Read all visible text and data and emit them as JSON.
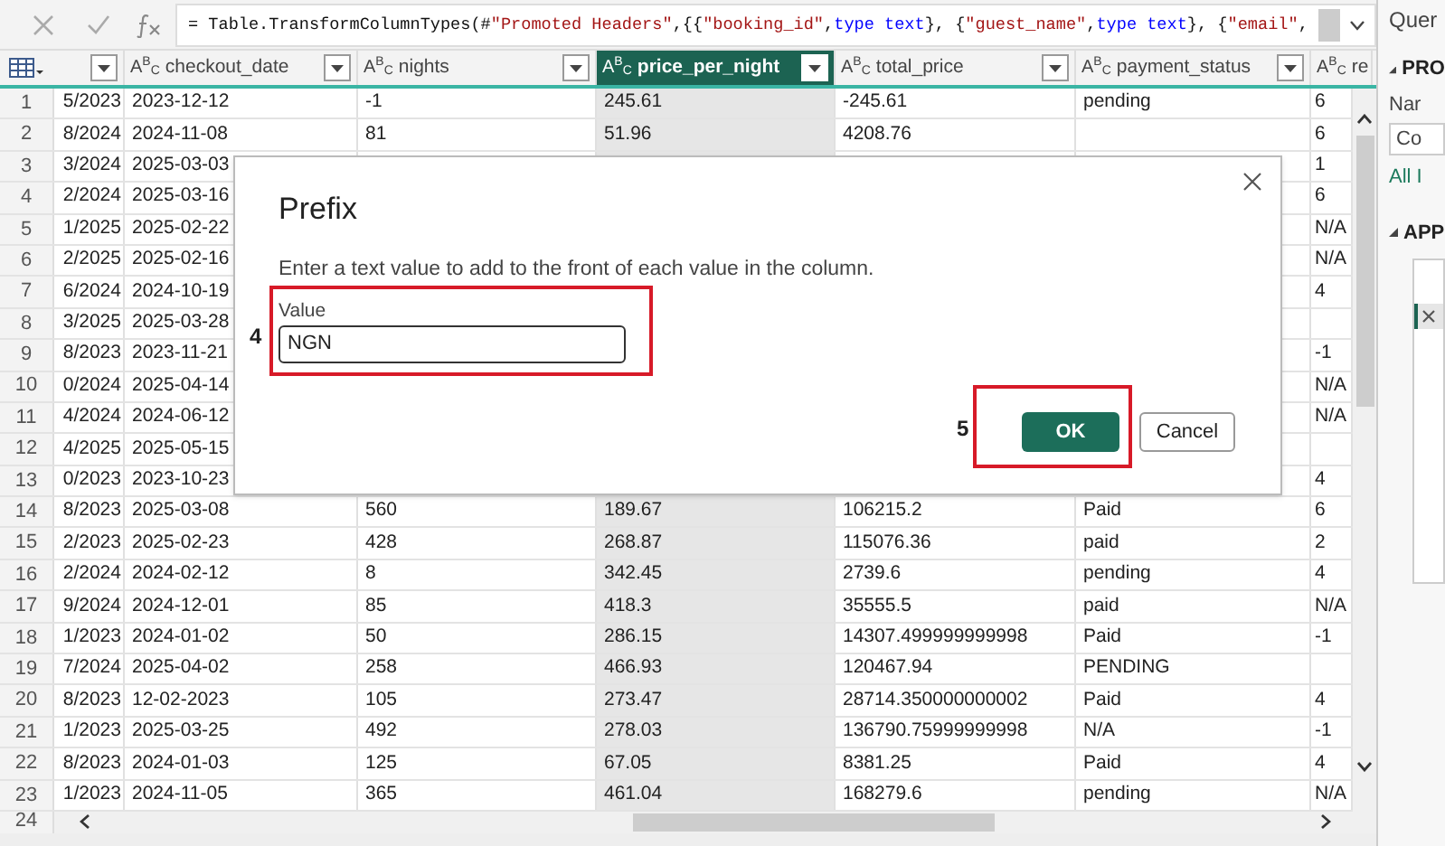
{
  "formula_bar": {
    "tokens": [
      {
        "kind": "plain",
        "text": "= Table.TransformColumnTypes(#"
      },
      {
        "kind": "string",
        "text": "\"Promoted Headers\""
      },
      {
        "kind": "plain",
        "text": ",{{"
      },
      {
        "kind": "string",
        "text": "\"booking_id\""
      },
      {
        "kind": "plain",
        "text": ", "
      },
      {
        "kind": "keyword",
        "text": "type text"
      },
      {
        "kind": "plain",
        "text": "}, {"
      },
      {
        "kind": "string",
        "text": "\"guest_name\""
      },
      {
        "kind": "plain",
        "text": ", "
      },
      {
        "kind": "keyword",
        "text": "type text"
      },
      {
        "kind": "plain",
        "text": "}, {"
      },
      {
        "kind": "string",
        "text": "\"email\""
      },
      {
        "kind": "plain",
        "text": ","
      }
    ]
  },
  "columns": [
    {
      "selected": false
    },
    {
      "type": "A$^{B}$$_{C}$",
      "name": "checkout_date",
      "selected": false
    },
    {
      "type": "A$^{B}$$_{C}$",
      "name": "nights",
      "selected": false
    },
    {
      "type": "A$^{B}$$_{C}$",
      "name": "price_per_night",
      "selected": true
    },
    {
      "type": "A$^{B}$$_{C}$",
      "name": "total_price",
      "selected": false
    },
    {
      "type": "A$^{B}$$_{C}$",
      "name": "payment_status",
      "selected": false
    },
    {
      "type": "A$^{B}$$_{C}$",
      "name": "re",
      "selected": false
    }
  ],
  "rows": [
    {
      "number": "1",
      "cells": [
        "5/2023",
        "2023-12-12",
        "-1",
        "245.61",
        "-245.61",
        "pending",
        "6"
      ]
    },
    {
      "number": "2",
      "cells": [
        "8/2024",
        "2024-11-08",
        "81",
        "51.96",
        "4208.76",
        null,
        "6"
      ]
    },
    {
      "number": "3",
      "cells": [
        "3/2024",
        "2025-03-03",
        null,
        null,
        null,
        null,
        "1"
      ]
    },
    {
      "number": "4",
      "cells": [
        "2/2024",
        "2025-03-16",
        null,
        null,
        null,
        null,
        "6"
      ]
    },
    {
      "number": "5",
      "cells": [
        "1/2025",
        "2025-02-22",
        null,
        null,
        null,
        null,
        "N/A"
      ]
    },
    {
      "number": "6",
      "cells": [
        "2/2025",
        "2025-02-16",
        null,
        null,
        null,
        null,
        "N/A"
      ]
    },
    {
      "number": "7",
      "cells": [
        "6/2024",
        "2024-10-19",
        null,
        null,
        null,
        null,
        "4"
      ]
    },
    {
      "number": "8",
      "cells": [
        "3/2025",
        "2025-03-28",
        null,
        null,
        null,
        null,
        null
      ]
    },
    {
      "number": "9",
      "cells": [
        "8/2023",
        "2023-11-21",
        null,
        null,
        null,
        null,
        "-1"
      ]
    },
    {
      "number": "10",
      "cells": [
        "0/2024",
        "2025-04-14",
        null,
        null,
        null,
        null,
        "N/A"
      ]
    },
    {
      "number": "11",
      "cells": [
        "4/2024",
        "2024-06-12",
        null,
        null,
        null,
        null,
        "N/A"
      ]
    },
    {
      "number": "12",
      "cells": [
        "4/2025",
        "2025-05-15",
        null,
        null,
        null,
        null,
        null
      ]
    },
    {
      "number": "13",
      "cells": [
        "0/2023",
        "2023-10-23",
        null,
        null,
        null,
        null,
        "4"
      ]
    },
    {
      "number": "14",
      "cells": [
        "8/2023",
        "2025-03-08",
        "560",
        "189.67",
        "106215.2",
        "Paid",
        "6"
      ]
    },
    {
      "number": "15",
      "cells": [
        "2/2023",
        "2025-02-23",
        "428",
        "268.87",
        "115076.36",
        "paid",
        "2"
      ]
    },
    {
      "number": "16",
      "cells": [
        "2/2024",
        "2024-02-12",
        "8",
        "342.45",
        "2739.6",
        "pending",
        "4"
      ]
    },
    {
      "number": "17",
      "cells": [
        "9/2024",
        "2024-12-01",
        "85",
        "418.3",
        "35555.5",
        "paid",
        "N/A"
      ]
    },
    {
      "number": "18",
      "cells": [
        "1/2023",
        "2024-01-02",
        "50",
        "286.15",
        "14307.499999999998",
        "Paid",
        "-1"
      ]
    },
    {
      "number": "19",
      "cells": [
        "7/2024",
        "2025-04-02",
        "258",
        "466.93",
        "120467.94",
        "PENDING",
        null
      ]
    },
    {
      "number": "20",
      "cells": [
        "8/2023",
        "12-02-2023",
        "105",
        "273.47",
        "28714.350000000002",
        "Paid",
        "4"
      ]
    },
    {
      "number": "21",
      "cells": [
        "1/2023",
        "2025-03-25",
        "492",
        "278.03",
        "136790.75999999998",
        "N/A",
        "-1"
      ]
    },
    {
      "number": "22",
      "cells": [
        "8/2023",
        "2024-01-03",
        "125",
        "67.05",
        "8381.25",
        "Paid",
        "4"
      ]
    },
    {
      "number": "23",
      "cells": [
        "1/2023",
        "2024-11-05",
        "365",
        "461.04",
        "168279.6",
        "pending",
        "N/A"
      ]
    }
  ],
  "last_row_number": "24",
  "dialog": {
    "title": "Prefix",
    "description": "Enter a text value to add to the front of each value in the column.",
    "field_label": "Value",
    "value": "NGN",
    "ok": "OK",
    "cancel": "Cancel"
  },
  "annotations": [
    {
      "kind": "field",
      "label": "4"
    },
    {
      "kind": "ok",
      "label": "5"
    }
  ],
  "side_panel": {
    "title": "Quer",
    "section_1": "PRO",
    "name_label": "Nar",
    "name_value": "Co",
    "link": "All I",
    "section_2": "APP"
  }
}
